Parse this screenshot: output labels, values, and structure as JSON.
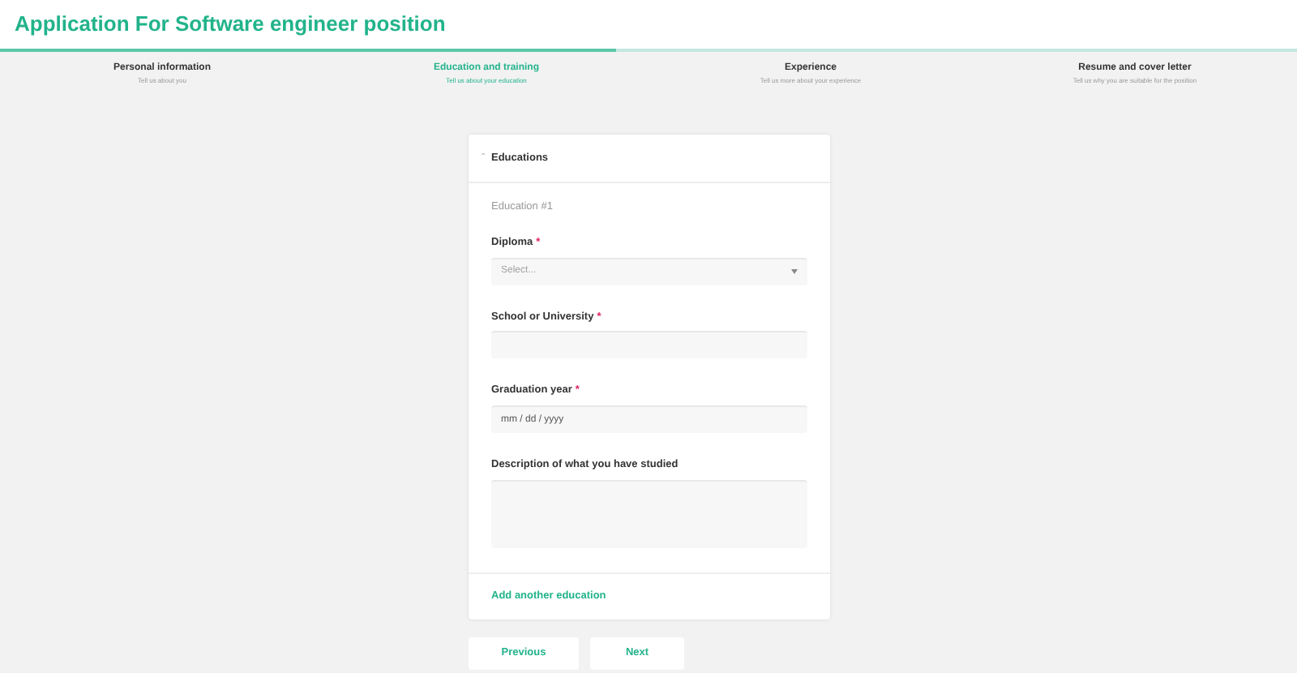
{
  "title": "Application For Software engineer position",
  "progress": {
    "level": 0.475
  },
  "steps": [
    {
      "label": "Personal information",
      "hint": "Tell us about you",
      "selected": false
    },
    {
      "label": "Education and training",
      "hint": "Tell us about your education",
      "selected": true
    },
    {
      "label": "Experience",
      "hint": "Tell us more about your experience",
      "selected": false
    },
    {
      "label": "Resume and cover letter",
      "hint": "Tell us why you are suitable for the position",
      "selected": false
    }
  ],
  "section": {
    "icon": "⌃",
    "title": "Educations",
    "expanded": true,
    "subtitle": "Education #1",
    "fields": [
      {
        "kind": "select",
        "label": "Diploma",
        "required_mark": "*",
        "placeholder": "Select..."
      },
      {
        "kind": "text",
        "label": "School or University",
        "required_mark": "*"
      },
      {
        "kind": "date",
        "label": "Graduation year",
        "required_mark": "*",
        "placeholder": "mm / dd / yyyy"
      },
      {
        "kind": "textarea",
        "label": "Description of what you have studied"
      }
    ],
    "add_link": "Add another education"
  },
  "buttons": [
    "Previous",
    "Next"
  ]
}
